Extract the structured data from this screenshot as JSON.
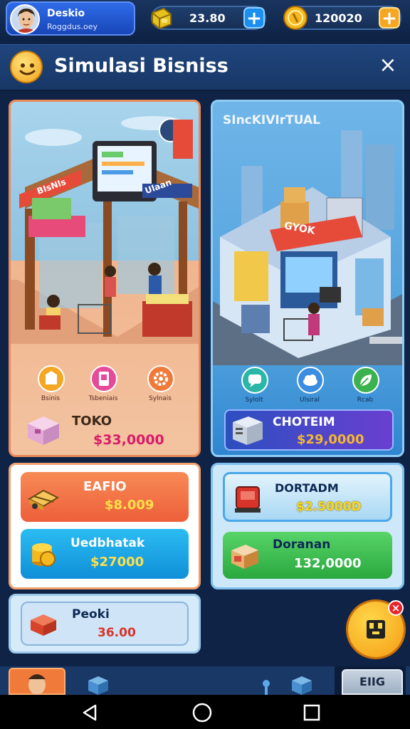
{
  "profile": {
    "name": "Deskio",
    "subtitle": "Roggdus.oey"
  },
  "resources": [
    {
      "value": "23.80",
      "icon": "cash-stack-icon"
    },
    {
      "value": "120020",
      "icon": "coin-icon"
    }
  ],
  "header": {
    "title": "Simulasi Bisniss",
    "close_label": "×"
  },
  "store_left": {
    "sign": "BIsNIs",
    "shop_sign": "Ulaan",
    "icons": [
      {
        "label": "Bsinis",
        "icon": "shop-icon",
        "color": "#f5a623"
      },
      {
        "label": "Tsbeniais",
        "icon": "tablet-icon",
        "color": "#e64b9a"
      },
      {
        "label": "Sylnais",
        "icon": "gear-icon",
        "color": "#f07a3a"
      }
    ],
    "name": "TOKO",
    "price": "$33,0000"
  },
  "store_right": {
    "title": "SIncKIVIrTUAL",
    "sign": "GYOK",
    "icons": [
      {
        "label": "Sylolt",
        "icon": "chat-icon",
        "color": "#2bb7a8"
      },
      {
        "label": "Ulsiral",
        "icon": "cloud-icon",
        "color": "#3a8de0"
      },
      {
        "label": "Rcab",
        "icon": "leaf-icon",
        "color": "#3cb24e"
      }
    ],
    "name": "CHOTEIM",
    "price": "$29,0000"
  },
  "left_offers": [
    {
      "name": "EAFIO",
      "value": "$8.009",
      "icon": "truck-icon",
      "color": "#f26a3f"
    },
    {
      "name": "Uedbhatak",
      "value": "$27000",
      "icon": "coin-stack-icon",
      "color": "#16a7e6"
    }
  ],
  "right_offers": [
    {
      "name": "DORTADM",
      "value": "$2.5000D",
      "icon": "machine-icon",
      "color": "#9fd4f2"
    },
    {
      "name": "Doranan",
      "value": "132,0000",
      "icon": "crate-icon",
      "color": "#3cc04f"
    }
  ],
  "left_extra": {
    "name": "Peoki",
    "value": "36.00",
    "icon": "box-icon"
  },
  "fab": {
    "badge": "×",
    "icon": "assistant-icon"
  },
  "bottom_nav": {
    "right_label": "EIIG"
  },
  "colors": {
    "bg": "#0f2347",
    "accent_orange": "#f5a623",
    "accent_blue": "#1c8ef0"
  }
}
